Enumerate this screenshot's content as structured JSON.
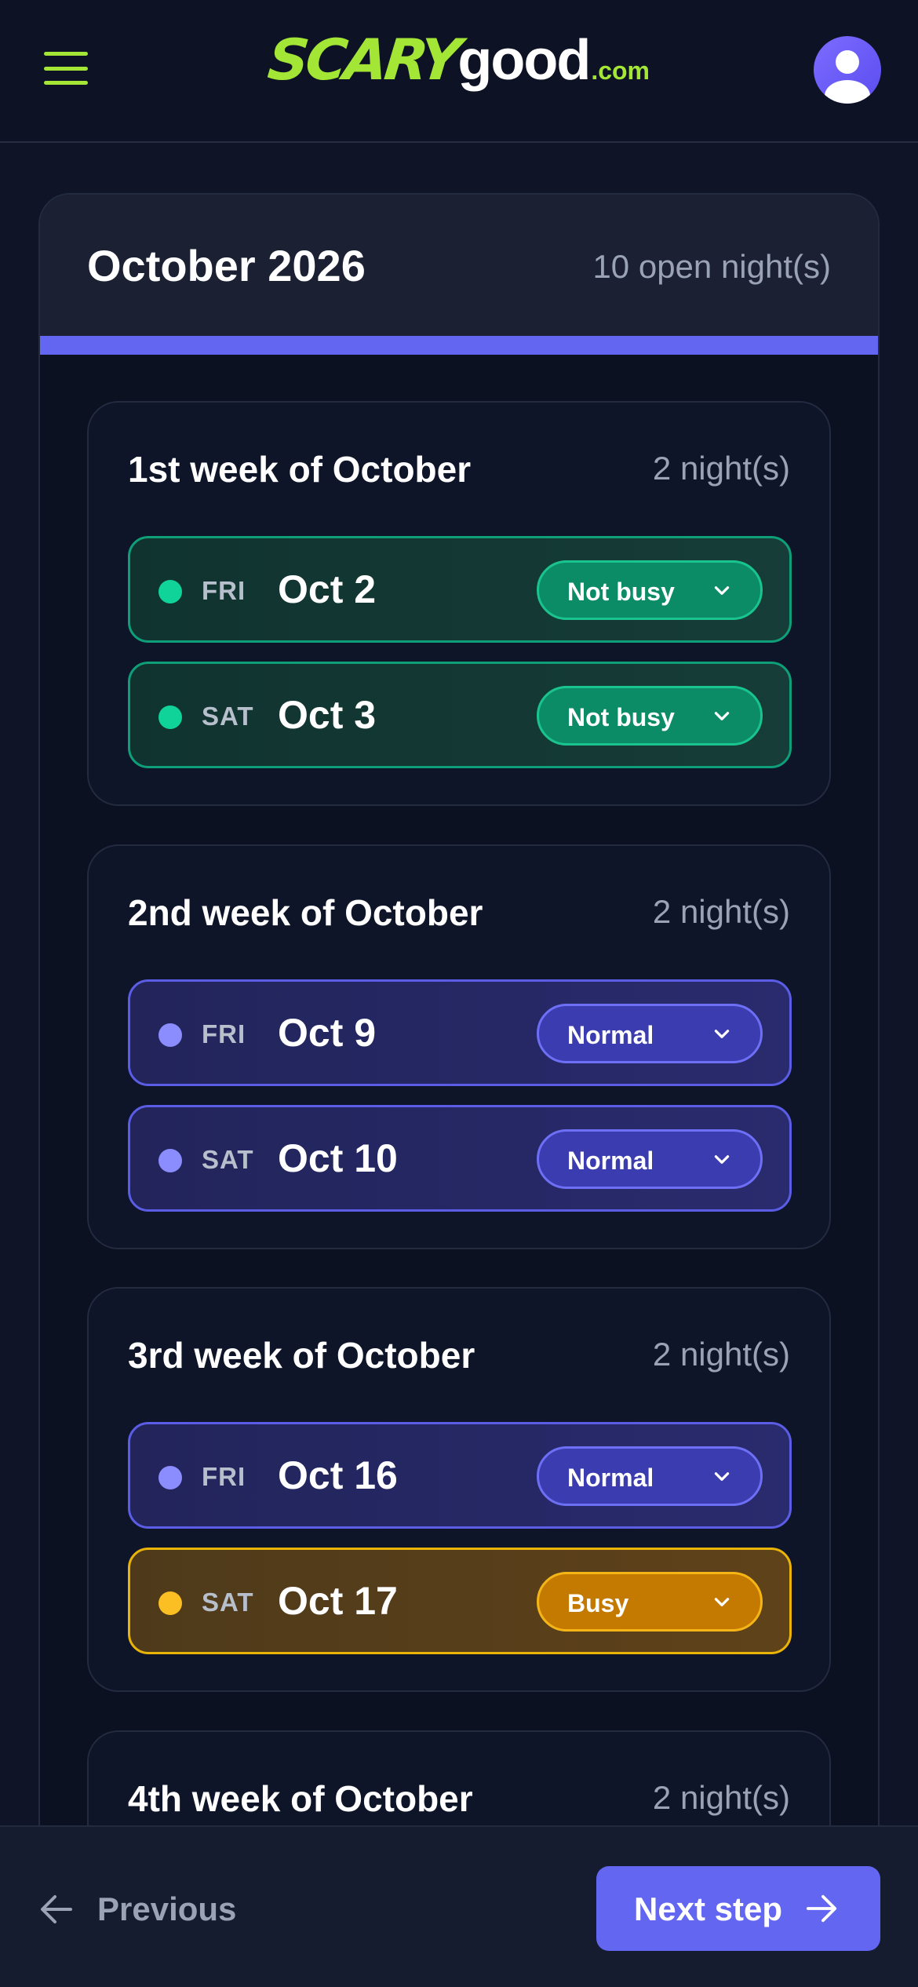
{
  "app": {
    "logo": {
      "scary": "SCARY",
      "good": "good",
      "com": ".com"
    }
  },
  "month": {
    "title": "October 2026",
    "open_nights": "10 open night(s)",
    "accent_color": "#6366f1"
  },
  "weeks": [
    {
      "title": "1st week of October",
      "count": "2 night(s)",
      "nights": [
        {
          "day": "FRI",
          "date": "Oct 2",
          "status": "Not busy",
          "tone": "green"
        },
        {
          "day": "SAT",
          "date": "Oct 3",
          "status": "Not busy",
          "tone": "green"
        }
      ]
    },
    {
      "title": "2nd week of October",
      "count": "2 night(s)",
      "nights": [
        {
          "day": "FRI",
          "date": "Oct 9",
          "status": "Normal",
          "tone": "blue"
        },
        {
          "day": "SAT",
          "date": "Oct 10",
          "status": "Normal",
          "tone": "blue"
        }
      ]
    },
    {
      "title": "3rd week of October",
      "count": "2 night(s)",
      "nights": [
        {
          "day": "FRI",
          "date": "Oct 16",
          "status": "Normal",
          "tone": "blue"
        },
        {
          "day": "SAT",
          "date": "Oct 17",
          "status": "Busy",
          "tone": "amber"
        }
      ]
    },
    {
      "title": "4th week of October",
      "count": "2 night(s)",
      "nights": []
    }
  ],
  "status_colors": {
    "not_busy": "#10d39a",
    "normal": "#8b8dff",
    "busy": "#fbbf24"
  },
  "footer": {
    "previous_label": "Previous",
    "next_label": "Next step"
  },
  "icons": {
    "menu": "hamburger-menu-icon",
    "profile": "user-avatar-icon",
    "dropdown": "chevron-down-icon",
    "previous": "arrow-left-icon",
    "next": "arrow-right-icon"
  }
}
